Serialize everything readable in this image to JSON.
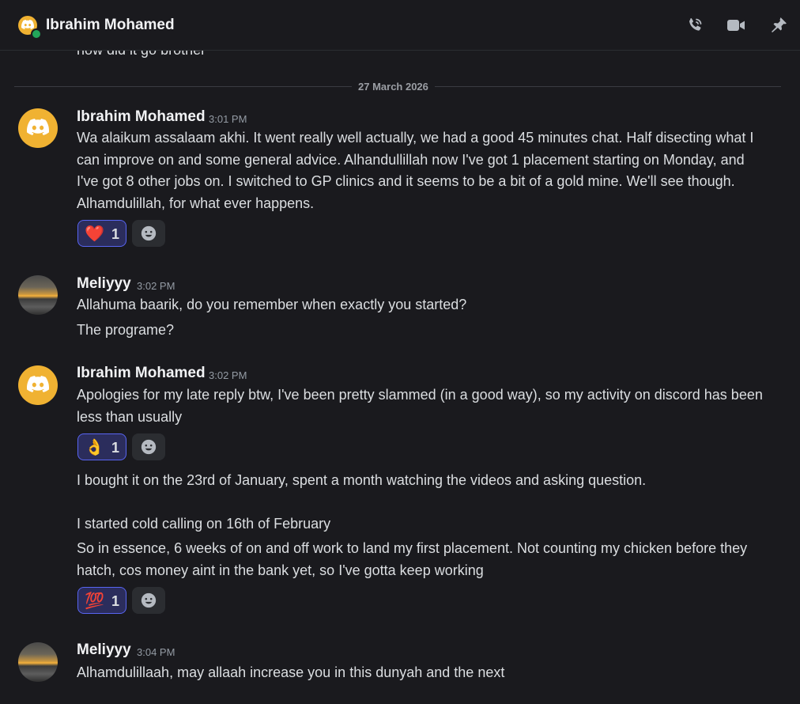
{
  "header": {
    "title": "Ibrahim Mohamed"
  },
  "icons": {
    "call": "phone-call-icon",
    "video": "video-camera-icon",
    "pin": "pin-icon",
    "add_reaction": "smiley-add-reaction-icon",
    "avatar_discord": "discord-logo-icon"
  },
  "colors": {
    "accent": "#5865f2",
    "avatar_yellow": "#f0b232",
    "online": "#23a55a"
  },
  "previous_message": {
    "text": "how did it go brother"
  },
  "divider": {
    "date": "27 March 2026"
  },
  "messages": [
    {
      "author": "Ibrahim Mohamed",
      "time": "3:01 PM",
      "text": "Wa alaikum assalaam akhi. It went really well actually, we had a good 45 minutes chat. Half disecting what I can improve on and some general advice. Alhandullillah now I've got 1 placement starting on Monday, and I've got  8 other jobs on. I switched to GP clinics and it seems to be a bit of a gold mine. We'll see though. Alhamdulillah, for what ever happens.",
      "reaction": {
        "emoji": "❤️",
        "count": "1"
      }
    },
    {
      "author": "Meliyyy",
      "time": "3:02 PM",
      "lines": [
        "Allahuma baarik, do you remember when exactly you started?",
        "The programe?"
      ]
    },
    {
      "author": "Ibrahim Mohamed",
      "time": "3:02 PM",
      "text": "Apologies for my late reply btw, I've been pretty slammed (in a good way), so my activity on discord has been less than usually",
      "reaction": {
        "emoji": "👌",
        "count": "1"
      },
      "followups": [
        "I bought it on the 23rd of January, spent a month watching the videos and asking question.",
        "I started cold calling on 16th of February",
        "So in essence, 6 weeks of on and off work to land my first placement. Not counting my chicken before they hatch, cos money aint in the bank yet, so I've gotta keep working"
      ],
      "reaction2": {
        "emoji": "💯",
        "count": "1"
      }
    },
    {
      "author": "Meliyyy",
      "time": "3:04 PM",
      "text": "Alhamdulillaah, may allaah increase you in this dunyah and the next"
    }
  ]
}
